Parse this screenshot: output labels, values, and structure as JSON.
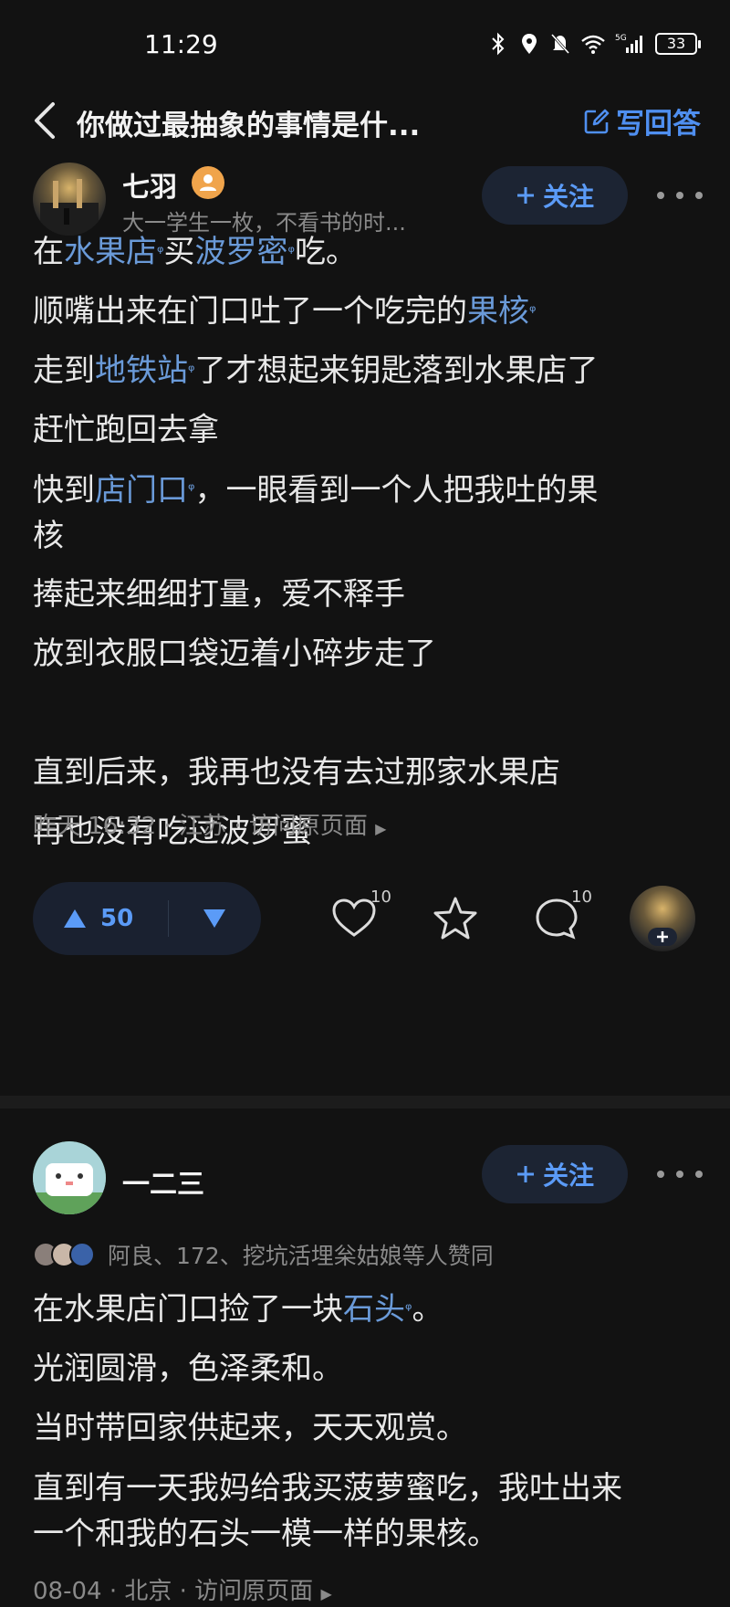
{
  "status": {
    "time": "11:29",
    "battery": "33"
  },
  "nav": {
    "title": "你做过最抽象的事情是什...",
    "write_label": "写回答"
  },
  "answer1": {
    "author": "七羽",
    "bio": "大一学生一枚，不看书的时...",
    "follow_label": "关注",
    "meta": {
      "date": "昨天 16:32",
      "location": "江苏",
      "link": "访问原页面"
    },
    "votes": "50",
    "like_count": "10",
    "comment_count": "10"
  },
  "answer2": {
    "author": "一二三",
    "follow_label": "关注",
    "endorsers_text": "阿良、172、挖坑活埋枀姑娘等人赞同",
    "meta": {
      "date": "08-04",
      "location": "北京",
      "link": "访问原页面"
    }
  },
  "a1": {
    "l1": {
      "t1": "在",
      "k1": "水果店",
      "t2": "买",
      "k2": "波罗密",
      "t3": "吃。"
    },
    "l2": {
      "t1": "顺嘴出来在门口吐了一个吃完的",
      "k1": "果核"
    },
    "l3": {
      "t1": "走到",
      "k1": "地铁站",
      "t2": "了才想起来钥匙落到水果店了"
    },
    "l4": "赶忙跑回去拿",
    "l5": {
      "t1": "快到",
      "k1": "店门口",
      "t2": "，一眼看到一个人把我吐的果",
      "t3": "核"
    },
    "l6": "捧起来细细打量，爱不释手",
    "l7": "放到衣服口袋迈着小碎步走了",
    "l8": "直到后来，我再也没有去过那家水果店",
    "l9": "再也没有吃过波罗蜜"
  },
  "a2": {
    "l1": {
      "t1": "在水果店门口捡了一块",
      "k1": "石头",
      "t2": "。"
    },
    "l2": "光润圆滑，色泽柔和。",
    "l3": "当时带回家供起来，天天观赏。",
    "l4": {
      "t1": "直到有一天我妈给我买菠萝蜜吃，我吐出来",
      "t2": "一个和我的石头一模一样的果核。"
    }
  },
  "colors": {
    "accent": "#5b9bf7",
    "keyword": "#6a9ad8",
    "background": "#121212"
  },
  "icons": [
    "back-chevron-icon",
    "edit-icon",
    "plus-icon",
    "more-dots-icon",
    "upvote-icon",
    "downvote-icon",
    "heart-icon",
    "star-icon",
    "comment-icon"
  ]
}
